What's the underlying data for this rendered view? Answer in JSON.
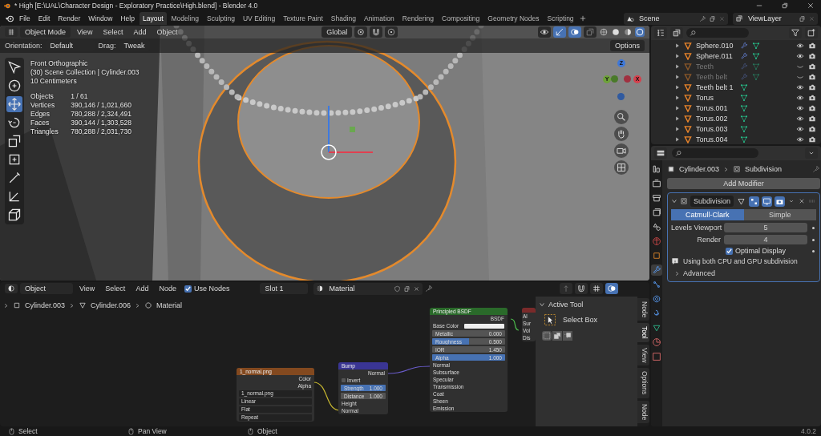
{
  "title_bar": {
    "title": "* High [E:\\UAL\\Character Design - Exploratory Practice\\High.blend] - Blender 4.0"
  },
  "menu": [
    "File",
    "Edit",
    "Render",
    "Window",
    "Help"
  ],
  "workspaces": [
    {
      "label": "Layout",
      "selected": true
    },
    {
      "label": "Modeling",
      "selected": false
    },
    {
      "label": "Sculpting",
      "selected": false
    },
    {
      "label": "UV Editing",
      "selected": false
    },
    {
      "label": "Texture Paint",
      "selected": false
    },
    {
      "label": "Shading",
      "selected": false
    },
    {
      "label": "Animation",
      "selected": false
    },
    {
      "label": "Rendering",
      "selected": false
    },
    {
      "label": "Compositing",
      "selected": false
    },
    {
      "label": "Geometry Nodes",
      "selected": false
    },
    {
      "label": "Scripting",
      "selected": false
    }
  ],
  "scene": "Scene",
  "view_layer": "ViewLayer",
  "viewport": {
    "mode": "Object Mode",
    "menus": [
      "View",
      "Select",
      "Add",
      "Object"
    ],
    "orientation": "Global",
    "tool_settings": {
      "orientation_label": "Orientation:",
      "orientation": "Default",
      "drag_label": "Drag:",
      "drag": "Tweak"
    },
    "options": "Options",
    "overlay_lines": [
      "Front Orthographic",
      "(30) Scene Collection | Cylinder.003",
      "10 Centimeters"
    ],
    "stats": [
      {
        "label": "Objects",
        "value": "1 / 61"
      },
      {
        "label": "Vertices",
        "value": "390,146 / 1,021,660"
      },
      {
        "label": "Edges",
        "value": "780,288 / 2,324,491"
      },
      {
        "label": "Faces",
        "value": "390,144 / 1,303,528"
      },
      {
        "label": "Triangles",
        "value": "780,288 / 2,031,730"
      }
    ],
    "tools": [
      {
        "selected": false
      },
      {
        "selected": false
      },
      {
        "selected": true
      },
      {
        "selected": false
      },
      {
        "selected": false
      },
      {
        "selected": false
      },
      {
        "selected": false
      },
      {
        "selected": false
      },
      {
        "selected": false
      }
    ],
    "gizmo_axes": [
      {
        "label": "Z",
        "color": "#3f78d8"
      },
      {
        "label": "Y",
        "color": "#6ea23a"
      },
      {
        "label": "X",
        "color": "#d6404c"
      }
    ]
  },
  "outliner": {
    "items": [
      {
        "name": "Sphere.010",
        "hidden": false,
        "modifier": true
      },
      {
        "name": "Sphere.011",
        "hidden": false,
        "modifier": true
      },
      {
        "name": "Teeth",
        "hidden": true,
        "modifier": true
      },
      {
        "name": "Teeth belt",
        "hidden": true,
        "modifier": true
      },
      {
        "name": "Teeth belt 1",
        "hidden": false,
        "modifier": false
      },
      {
        "name": "Torus",
        "hidden": false,
        "modifier": false
      },
      {
        "name": "Torus.001",
        "hidden": false,
        "modifier": false
      },
      {
        "name": "Torus.002",
        "hidden": false,
        "modifier": false
      },
      {
        "name": "Torus.003",
        "hidden": false,
        "modifier": false
      },
      {
        "name": "Torus.004",
        "hidden": false,
        "modifier": false
      }
    ]
  },
  "properties": {
    "tabs": [
      {
        "selected": false
      },
      {
        "selected": false
      },
      {
        "selected": false
      },
      {
        "selected": false
      },
      {
        "selected": false
      },
      {
        "selected": false
      },
      {
        "selected": false
      },
      {
        "selected": true
      },
      {
        "selected": false
      },
      {
        "selected": false
      },
      {
        "selected": false
      },
      {
        "selected": false
      },
      {
        "selected": false
      },
      {
        "selected": false
      }
    ],
    "object": "Cylinder.003",
    "context": "Subdivision",
    "add_modifier": "Add Modifier",
    "modifier": {
      "name": "Subdivision",
      "expanded": true,
      "types": [
        {
          "label": "Catmull-Clark",
          "selected": true
        },
        {
          "label": "Simple",
          "selected": false
        }
      ],
      "fields": [
        {
          "label": "Levels Viewport",
          "value": "5"
        },
        {
          "label": "Render",
          "value": "4"
        }
      ],
      "optimal_display": {
        "label": "Optimal Display",
        "checked": true
      },
      "info": "Using both CPU and GPU subdivision",
      "advanced": "Advanced"
    }
  },
  "node_editor": {
    "mode": "Object",
    "menus": [
      "View",
      "Select",
      "Add",
      "Node"
    ],
    "use_nodes": {
      "label": "Use Nodes",
      "checked": true
    },
    "slot": "Slot 1",
    "material": "Material",
    "breadcrumbs": [
      "Cylinder.003",
      "Cylinder.006",
      "Material"
    ],
    "image_node": {
      "title": "1_normal.png",
      "outputs": [
        "Color",
        "Alpha"
      ],
      "file": "1_normal.png",
      "options": [
        "Linear",
        "Flat",
        "Repeat"
      ]
    },
    "bump_node": {
      "title": "Bump",
      "output": "Normal",
      "invert": {
        "label": "Invert",
        "checked": false
      },
      "fields": [
        {
          "label": "Strength",
          "value": "1.000",
          "level": 1
        },
        {
          "label": "Distance",
          "value": "1.000",
          "level": 0
        }
      ],
      "inputs": [
        "Height",
        "Normal"
      ]
    },
    "bsdf_node": {
      "title": "Principled BSDF",
      "output": "BSDF",
      "base_color": "Base Color",
      "fields": [
        {
          "label": "Metallic",
          "value": "0.000",
          "level": 0
        },
        {
          "label": "Roughness",
          "value": "0.500",
          "level": 0.5
        },
        {
          "label": "IOR",
          "value": "1.450",
          "level": 0
        },
        {
          "label": "Alpha",
          "value": "1.000",
          "level": 1
        }
      ],
      "normal": "Normal",
      "panels": [
        "Subsurface",
        "Specular",
        "Transmission",
        "Coat",
        "Sheen",
        "Emission"
      ]
    },
    "output_node": {
      "rows": [
        "Al",
        "Sur",
        "Vol",
        "Dis"
      ]
    },
    "sidebar": {
      "tabs": [
        {
          "label": "Node",
          "selected": false
        },
        {
          "label": "Tool",
          "selected": true
        },
        {
          "label": "View",
          "selected": false
        },
        {
          "label": "Options",
          "selected": false
        },
        {
          "label": "Node",
          "selected": false
        }
      ],
      "panel": "Active Tool",
      "tool": "Select Box"
    }
  },
  "status_bar": {
    "items": [
      "Select",
      "Pan View",
      "Object"
    ],
    "version": "4.0.2"
  }
}
